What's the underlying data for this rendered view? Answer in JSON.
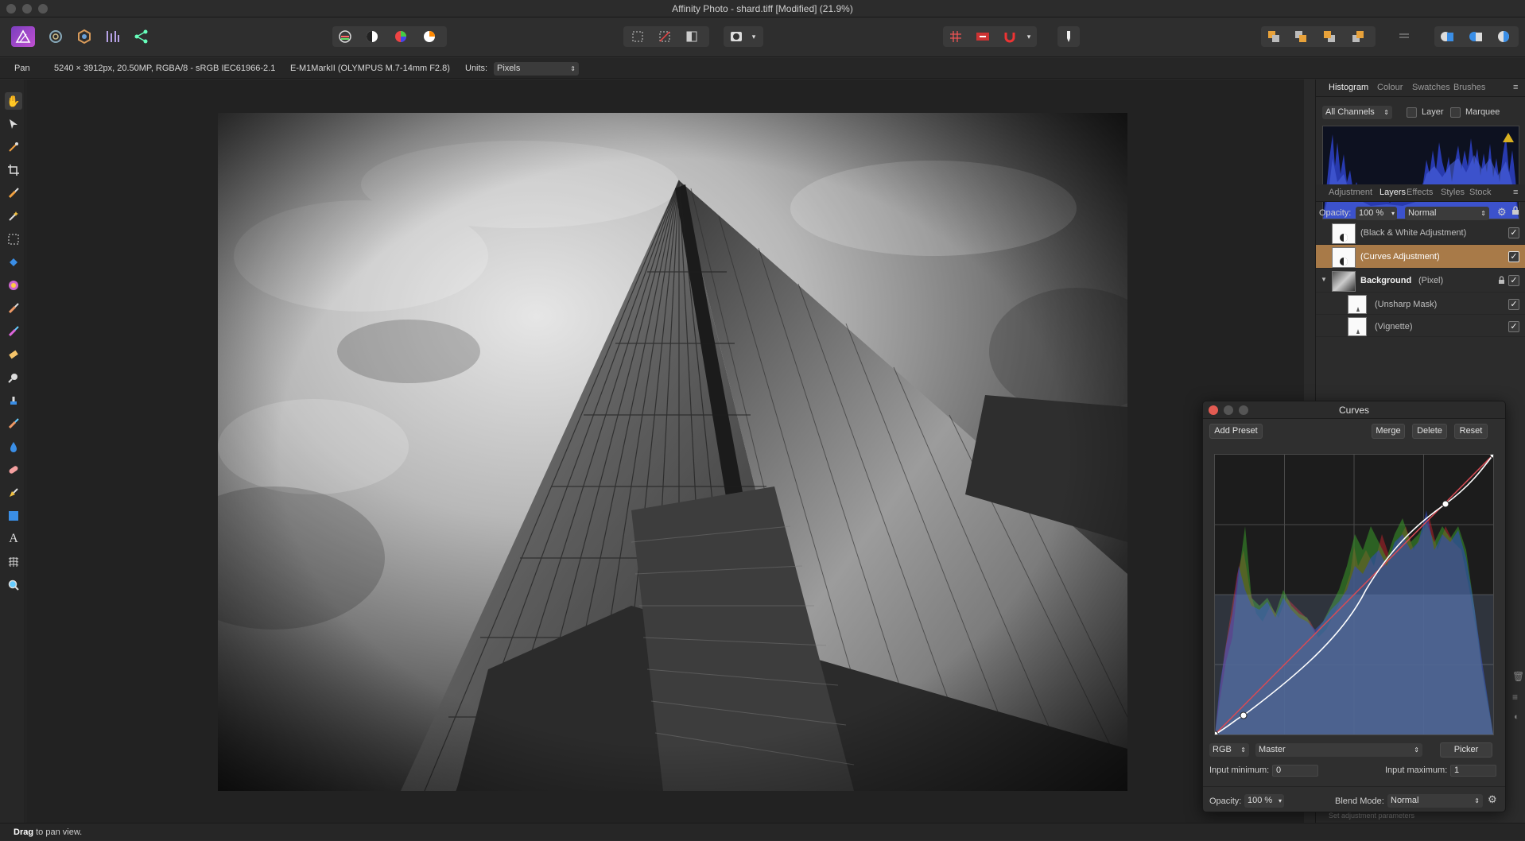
{
  "window": {
    "title": "Affinity Photo - shard.tiff [Modified] (21.9%)"
  },
  "toolbar": {
    "personas": [
      "photo-persona-icon",
      "liquify-persona-icon",
      "develop-persona-icon",
      "tone-mapping-persona-icon",
      "export-persona-icon"
    ]
  },
  "context_bar": {
    "tool_name": "Pan",
    "document_info": "5240 × 3912px, 20.50MP, RGBA/8 - sRGB IEC61966-2.1",
    "camera_info": "E-M1MarkII (OLYMPUS M.7-14mm F2.8)",
    "units_label": "Units:",
    "units_value": "Pixels"
  },
  "histogram_panel": {
    "tabs": [
      "Histogram",
      "Colour",
      "Swatches",
      "Brushes"
    ],
    "active_tab": "Histogram",
    "channel": "All Channels",
    "layer_label": "Layer",
    "marquee_label": "Marquee"
  },
  "layers_panel": {
    "tabs": [
      "Adjustment",
      "Layers",
      "Effects",
      "Styles",
      "Stock"
    ],
    "active_tab": "Layers",
    "opacity_label": "Opacity:",
    "opacity_value": "100 %",
    "blend_mode": "Normal",
    "layers": [
      {
        "name": "(Black & White Adjustment)",
        "visible": true
      },
      {
        "name": "(Curves Adjustment)",
        "visible": true,
        "selected": true
      },
      {
        "name": "Background",
        "suffix": "(Pixel)",
        "visible": true,
        "locked": true
      },
      {
        "name": "(Unsharp Mask)",
        "visible": true
      },
      {
        "name": "(Vignette)",
        "visible": true
      }
    ]
  },
  "curves_dialog": {
    "title": "Curves",
    "add_preset_label": "Add Preset",
    "merge_label": "Merge",
    "delete_label": "Delete",
    "reset_label": "Reset",
    "color_space": "RGB",
    "channel": "Master",
    "picker_label": "Picker",
    "input_min_label": "Input minimum:",
    "input_min_value": "0",
    "input_max_label": "Input maximum:",
    "input_max_value": "1",
    "opacity_label": "Opacity:",
    "opacity_value": "100 %",
    "blend_mode_label": "Blend Mode:",
    "blend_mode_value": "Normal"
  },
  "adjustment_hint": "Set adjustment parameters",
  "status_bar": {
    "bold": "Drag",
    "rest": " to pan view."
  }
}
